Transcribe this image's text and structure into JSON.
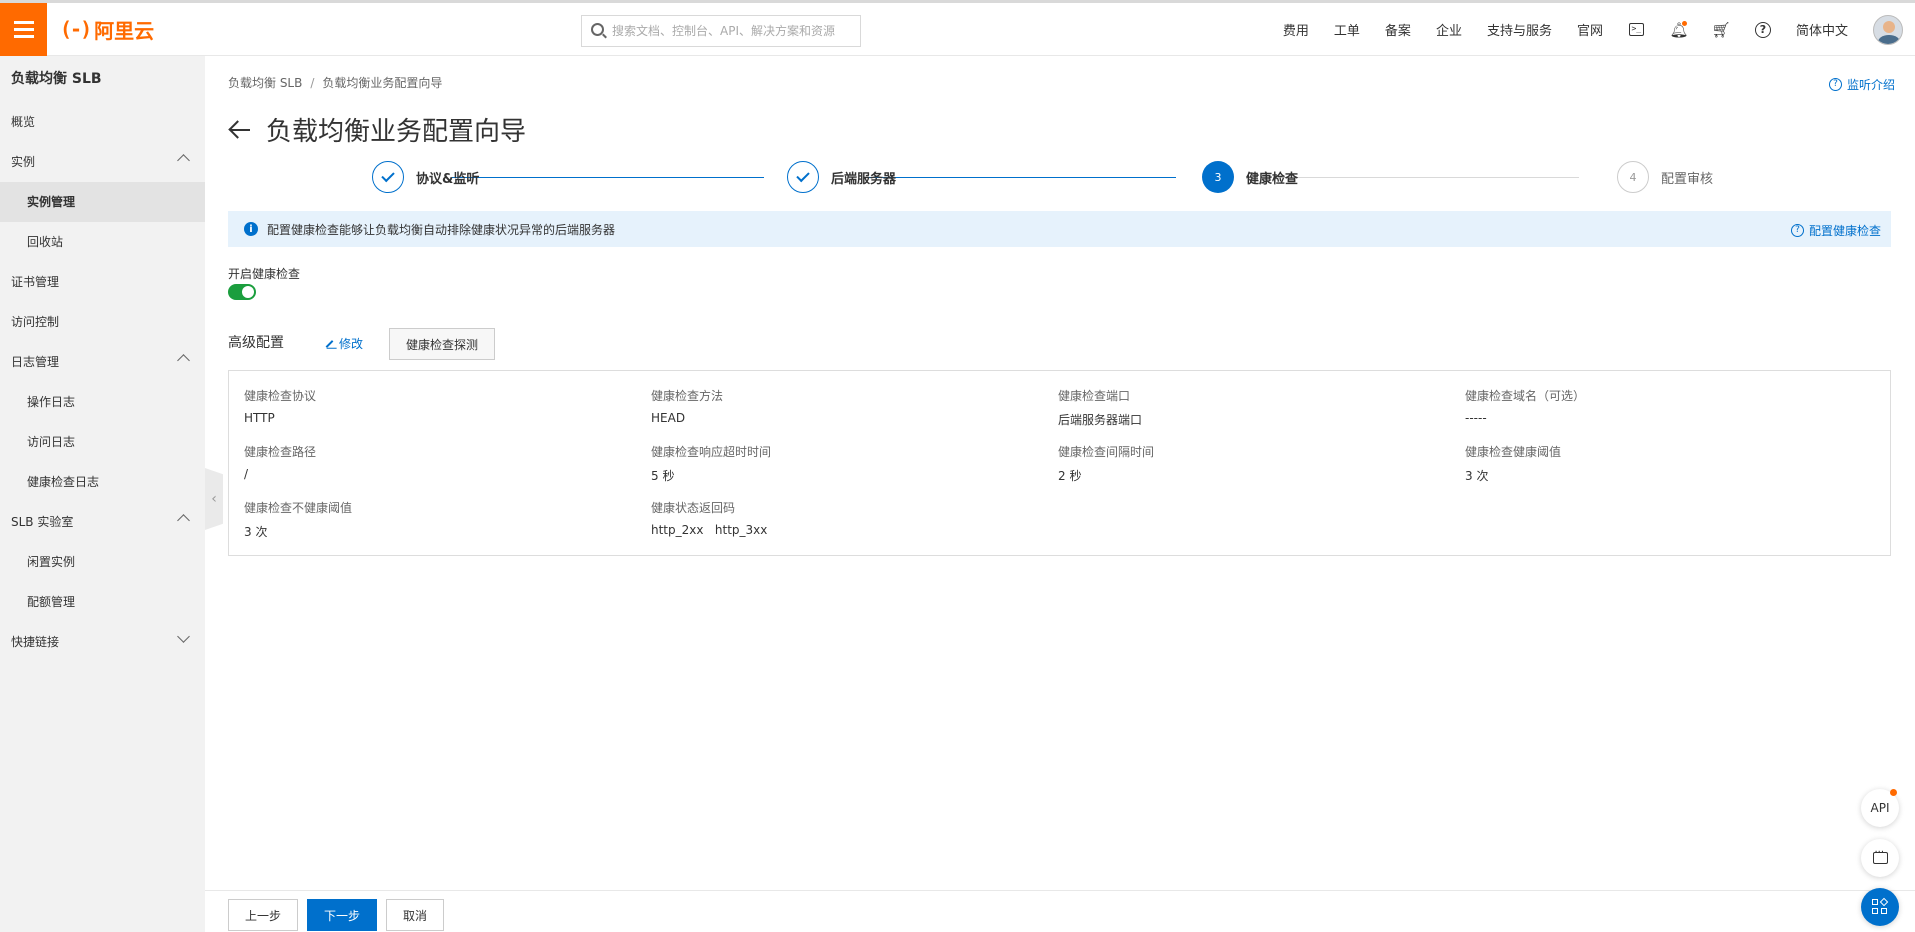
{
  "header": {
    "logo_text": "阿里云",
    "logo_bracket": "(-)",
    "search_placeholder": "搜索文档、控制台、API、解决方案和资源",
    "nav": [
      "费用",
      "工单",
      "备案",
      "企业",
      "支持与服务",
      "官网"
    ],
    "language": "简体中文",
    "icons": [
      "terminal-icon",
      "bell-icon",
      "cart-icon",
      "help-icon"
    ]
  },
  "sidebar": {
    "title": "负载均衡 SLB",
    "items": [
      {
        "label": "概览"
      },
      {
        "label": "实例"
      },
      {
        "label": "实例管理"
      },
      {
        "label": "回收站"
      },
      {
        "label": "证书管理"
      },
      {
        "label": "访问控制"
      },
      {
        "label": "日志管理"
      },
      {
        "label": "操作日志"
      },
      {
        "label": "访问日志"
      },
      {
        "label": "健康检查日志"
      },
      {
        "label": "SLB 实验室"
      },
      {
        "label": "闲置实例"
      },
      {
        "label": "配额管理"
      },
      {
        "label": "快捷链接"
      }
    ]
  },
  "breadcrumb": {
    "root": "负载均衡 SLB",
    "sep": "/",
    "current": "负载均衡业务配置向导"
  },
  "help_link": "监听介绍",
  "page_title": "负载均衡业务配置向导",
  "steps": [
    {
      "index": "1",
      "label": "协议&监听",
      "status": "done"
    },
    {
      "index": "2",
      "label": "后端服务器",
      "status": "done"
    },
    {
      "index": "3",
      "label": "健康检查",
      "status": "current"
    },
    {
      "index": "4",
      "label": "配置审核",
      "status": "todo"
    }
  ],
  "info_bar": {
    "text": "配置健康检查能够让负载均衡自动排除健康状况异常的后端服务器",
    "link": "配置健康检查"
  },
  "health_check": {
    "toggle_label": "开启健康检查",
    "enabled": true
  },
  "advanced": {
    "title": "高级配置",
    "edit_label": "修改",
    "probe_button": "健康检查探测",
    "fields": [
      {
        "key": "健康检查协议",
        "value": "HTTP"
      },
      {
        "key": "健康检查方法",
        "value": "HEAD"
      },
      {
        "key": "健康检查端口",
        "value": "后端服务器端口"
      },
      {
        "key": "健康检查域名（可选）",
        "value": "-----"
      },
      {
        "key": "健康检查路径",
        "value": "/"
      },
      {
        "key": "健康检查响应超时时间",
        "value": "5 秒"
      },
      {
        "key": "健康检查间隔时间",
        "value": "2 秒"
      },
      {
        "key": "健康检查健康阈值",
        "value": "3 次"
      },
      {
        "key": "健康检查不健康阈值",
        "value": "3 次"
      },
      {
        "key": "健康状态返回码",
        "value": "http_2xx   http_3xx"
      }
    ]
  },
  "footer": {
    "prev": "上一步",
    "next": "下一步",
    "cancel": "取消"
  },
  "floating": {
    "api": "API"
  },
  "colors": {
    "brand": "#ff6a00",
    "primary": "#0070cc",
    "toggle_on": "#1b9e3e",
    "info_bg": "#e6f2fc"
  }
}
